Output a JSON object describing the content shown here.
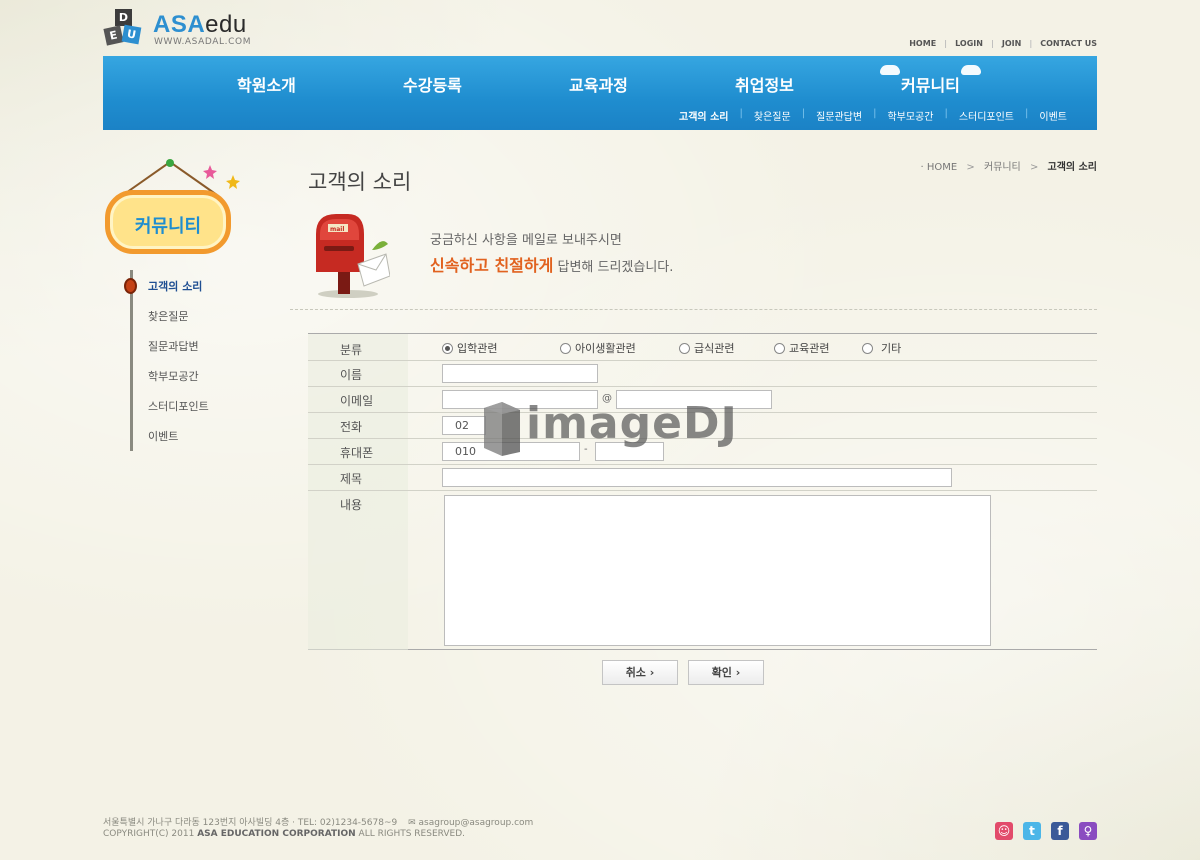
{
  "logo": {
    "cube_letters": [
      "D",
      "E",
      "U"
    ],
    "brand": "ASA",
    "suffix": "edu",
    "url": "WWW.ASADAL.COM"
  },
  "util_links": [
    "HOME",
    "LOGIN",
    "JOIN",
    "CONTACT US"
  ],
  "nav": {
    "items": [
      "학원소개",
      "수강등록",
      "교육과정",
      "취업정보",
      "커뮤니티"
    ],
    "sub_items": [
      "고객의 소리",
      "찾은질문",
      "질문관답변",
      "학부모공간",
      "스터디포인트",
      "이벤트"
    ]
  },
  "sidebar": {
    "sign_title": "커뮤니티",
    "items": [
      "고객의 소리",
      "찾은질문",
      "질문과답변",
      "학부모공간",
      "스터디포인트",
      "이벤트"
    ]
  },
  "breadcrumb": {
    "home": "· HOME",
    "section": "커뮤니티",
    "current": "고객의 소리"
  },
  "page": {
    "title": "고객의 소리",
    "mailbox_tag": "mail",
    "intro_line1": "궁금하신 사항을 메일로 보내주시면",
    "intro_highlight": "신속하고 친절하게",
    "intro_rest": "답변해 드리겠습니다."
  },
  "form": {
    "labels": {
      "category": "분류",
      "name": "이름",
      "email": "이메일",
      "phone": "전화",
      "mobile": "휴대폰",
      "subject": "제목",
      "content": "내용"
    },
    "category_options": [
      "입학관련",
      "아이생활관련",
      "급식관련",
      "교육관련",
      "기타"
    ],
    "selected_category": "입학관련",
    "email_at": "@",
    "phone_prefix": "02",
    "mobile_prefix": "010",
    "mobile_dash": "-",
    "cancel_label": "취소 ›",
    "submit_label": "확인 ›"
  },
  "watermark": "imageDJ",
  "footer": {
    "address": "서울특별시 가나구 다라동 123번지 아사빌딩 4층 · TEL: 02)1234-5678~9",
    "email": "asagroup@asagroup.com",
    "copyright_prefix": "COPYRIGHT(C) 2011",
    "company": "ASA EDUCATION CORPORATION",
    "copyright_suffix": "ALL RIGHTS RESERVED."
  },
  "colors": {
    "nav_blue": "#1f8dcf",
    "accent_orange": "#e1621f",
    "sign_orange": "#f29a2e",
    "sidebar_active": "#1f4f92"
  }
}
